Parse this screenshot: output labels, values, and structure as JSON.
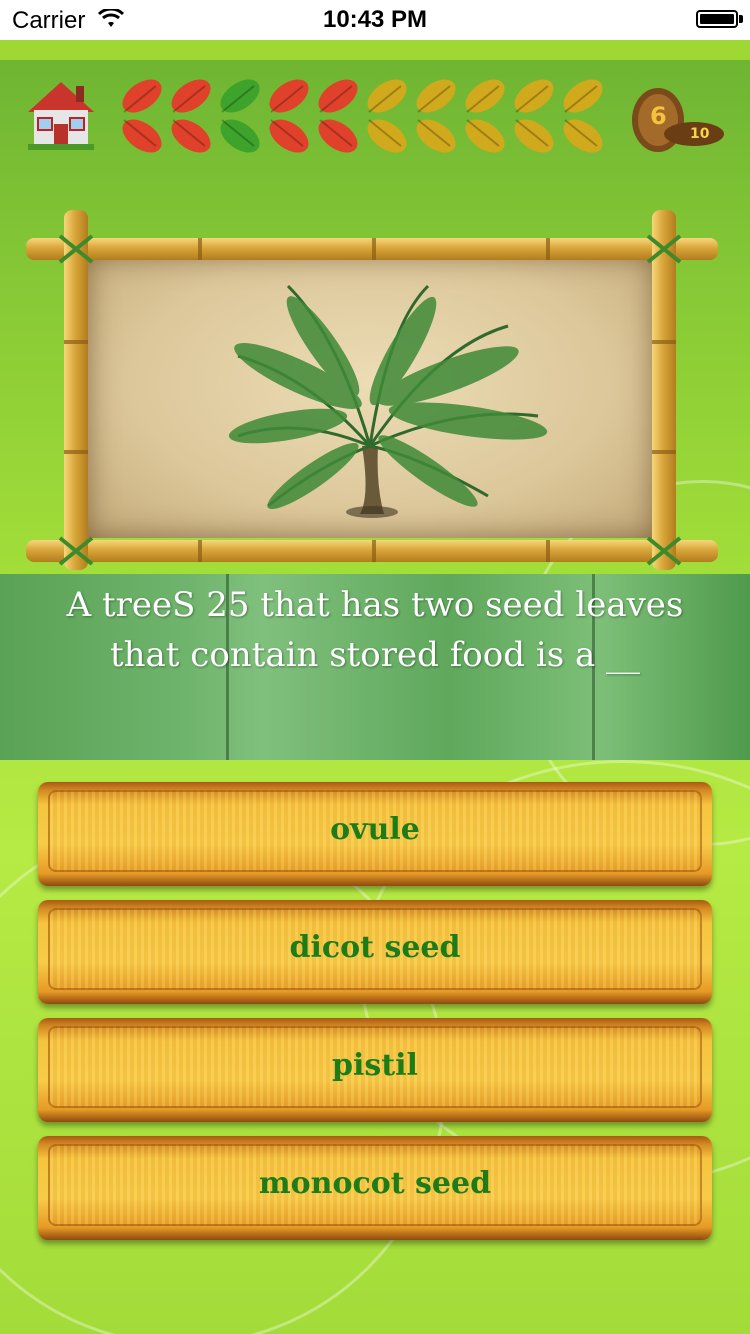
{
  "status_bar": {
    "carrier": "Carrier",
    "time": "10:43 PM"
  },
  "hud": {
    "home_icon": "house-icon",
    "leaves": [
      {
        "state": "red",
        "color": "#e0412a"
      },
      {
        "state": "red",
        "color": "#e0412a"
      },
      {
        "state": "green",
        "color": "#3ea32b"
      },
      {
        "state": "red",
        "color": "#e0412a"
      },
      {
        "state": "red",
        "color": "#e0412a"
      },
      {
        "state": "yellow",
        "color": "#d1a91c"
      },
      {
        "state": "yellow",
        "color": "#d1a91c"
      },
      {
        "state": "yellow",
        "color": "#d1a91c"
      },
      {
        "state": "yellow",
        "color": "#d1a91c"
      },
      {
        "state": "yellow",
        "color": "#d1a91c"
      }
    ],
    "seed_counter": {
      "current": "6",
      "total": "10"
    }
  },
  "question": {
    "image_icon": "palm-tree-image",
    "text": "A treeS 25 that has two seed leaves that contain stored food is a __"
  },
  "answers": [
    {
      "label": "ovule"
    },
    {
      "label": "dicot seed"
    },
    {
      "label": "pistil"
    },
    {
      "label": "monocot seed"
    }
  ],
  "colors": {
    "answer_text": "#1c7d18",
    "background": "#a8e23a"
  }
}
